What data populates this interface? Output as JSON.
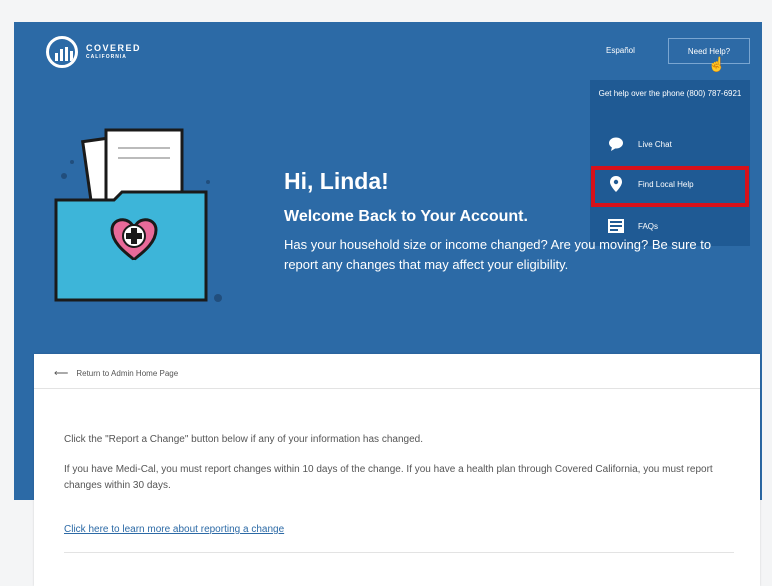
{
  "header": {
    "brand_line1": "COVERED",
    "brand_line2": "CALIFORNIA",
    "language_link": "Español",
    "need_help_button": "Need Help?"
  },
  "help_menu": {
    "phone_text": "Get help over the phone (800) 787-6921",
    "items": [
      {
        "label": "Live Chat",
        "icon": "chat-bubble-icon"
      },
      {
        "label": "Find Local Help",
        "icon": "location-pin-icon"
      },
      {
        "label": "FAQs",
        "icon": "faq-icon"
      }
    ],
    "highlight_color": "#d7111b"
  },
  "hero": {
    "greeting": "Hi, Linda!",
    "welcome": "Welcome Back to Your Account.",
    "message": "Has your household size or income changed? Are you moving? Be sure to report any changes that may affect your eligibility.",
    "background_color": "#2c6aa6"
  },
  "card": {
    "back_link": "Return to Admin Home Page",
    "paragraph1": "Click the \"Report a Change\" button below if any of your information has changed.",
    "paragraph2": "If you have Medi-Cal, you must report changes within 10 days of the change. If you have a health plan through Covered California, you must report changes within 30 days.",
    "learn_more_link": "Click here to learn more about reporting a change"
  }
}
